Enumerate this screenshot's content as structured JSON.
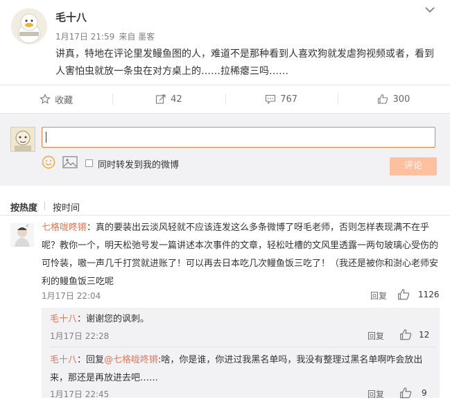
{
  "post": {
    "author": "毛十八",
    "date": "1月17日 21:59",
    "source_prefix": "来自",
    "source": "墨客",
    "text": "讲真，特地在评论里发鳗鱼图的人，难道不是那种看到人喜欢狗就发虐狗视频或者，看到人害怕虫就放一条虫在对方桌上的……拉稀瘪三吗……"
  },
  "actions": {
    "favorite": "收藏",
    "repost": "42",
    "comment": "767",
    "like": "300"
  },
  "composer": {
    "input_value": "",
    "repost_label": "同时转发到我的微博",
    "submit_label": "评论"
  },
  "sort": {
    "hot": "按热度",
    "time": "按时间"
  },
  "comment": {
    "user": "七格咙咚锵",
    "text": "：真的要装出云淡风轻就不应该连发这么多条微博了呀毛老师，否则怎样表现满不在乎呢？教你一个，明天松弛号发一篇讲述本次事件的文章，轻松吐槽的文风里透露一两句玻璃心受伤的可怜装，嗷一声几千打赏就进账了！可以再去日本吃几次鳗鱼饭三吃了！（我还是被你和澍心老师安利的鳗鱼饭三吃呢",
    "time": "1月17日 22:04",
    "reply": "回复",
    "likes": "1126"
  },
  "replies": [
    {
      "user": "毛十八",
      "text": "：谢谢您的讽刺。",
      "time": "1月17日 22:28",
      "reply": "回复",
      "likes": "12"
    },
    {
      "user": "毛十八",
      "text_prefix": "：回复",
      "mention": "@七格咙咚锵",
      "text": ":啥，你是谁，你进过我黑名单吗，我没有整理过黑名单啊咋会放出来，那还是再放进去吧……",
      "time": "1月17日 22:45",
      "reply": "回复",
      "likes": "9"
    }
  ],
  "colors": {
    "accent": "#eb7350",
    "input_border": "#fa7d3c",
    "submit_bg": "#ffc09f"
  }
}
